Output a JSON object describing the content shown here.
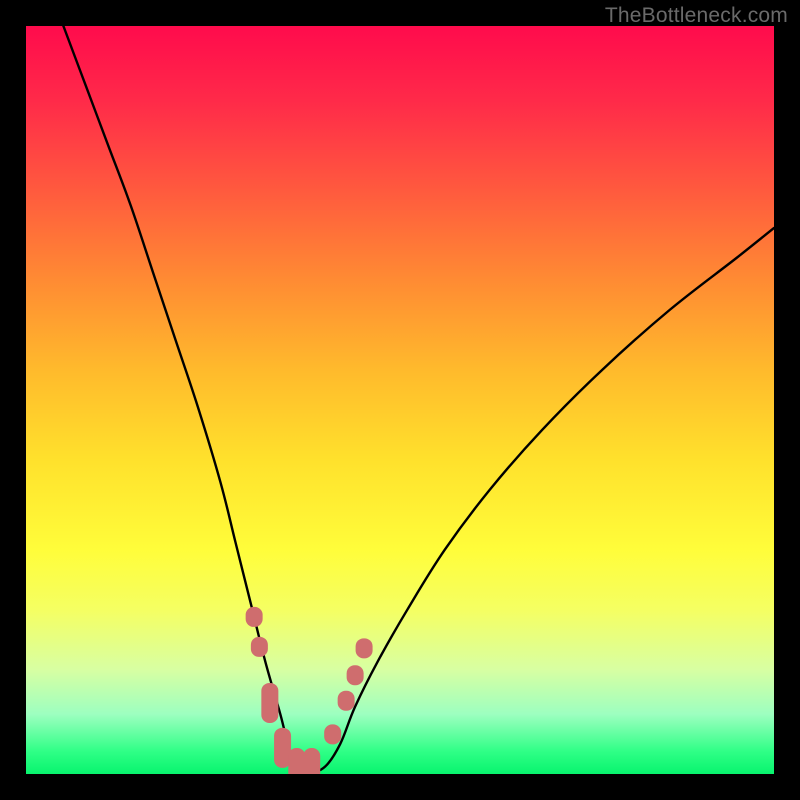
{
  "watermark": {
    "text": "TheBottleneck.com"
  },
  "colors": {
    "background": "#000000",
    "curve": "#000000",
    "markers": "#cf6d6e",
    "gradient_top": "#ff0b4c",
    "gradient_bottom": "#08f46e"
  },
  "chart_data": {
    "type": "line",
    "title": "",
    "xlabel": "",
    "ylabel": "",
    "xlim": [
      0,
      100
    ],
    "ylim": [
      0,
      100
    ],
    "note": "V-shaped bottleneck curve over a red-to-green vertical gradient. Curve reaches y≈0 near x≈36 then rises again. Series values are estimated from pixel positions (normalized to 0–100 plot coordinates).",
    "series": [
      {
        "name": "bottleneck-curve",
        "x": [
          5,
          8,
          11,
          14,
          17,
          20,
          23,
          26,
          28,
          30,
          32,
          34,
          35,
          36,
          38,
          40,
          42,
          44,
          47,
          51,
          56,
          62,
          69,
          77,
          86,
          95,
          100
        ],
        "y": [
          100,
          92,
          84,
          76,
          67,
          58,
          49,
          39,
          31,
          23,
          15,
          8,
          4,
          1,
          0.3,
          1,
          4,
          9,
          15,
          22,
          30,
          38,
          46,
          54,
          62,
          69,
          73
        ]
      }
    ],
    "markers": {
      "name": "highlight-points",
      "shape": "rounded-rect",
      "color": "#cf6d6e",
      "points": [
        {
          "x": 30.5,
          "y": 21
        },
        {
          "x": 31.2,
          "y": 17
        },
        {
          "x": 32.6,
          "y": 9.5,
          "elongated": true
        },
        {
          "x": 34.3,
          "y": 3.5,
          "elongated": true
        },
        {
          "x": 36.2,
          "y": 0.8,
          "elongated": true
        },
        {
          "x": 38.2,
          "y": 0.8,
          "elongated": true
        },
        {
          "x": 41.0,
          "y": 5.3
        },
        {
          "x": 42.8,
          "y": 9.8
        },
        {
          "x": 44.0,
          "y": 13.2
        },
        {
          "x": 45.2,
          "y": 16.8
        }
      ]
    }
  }
}
